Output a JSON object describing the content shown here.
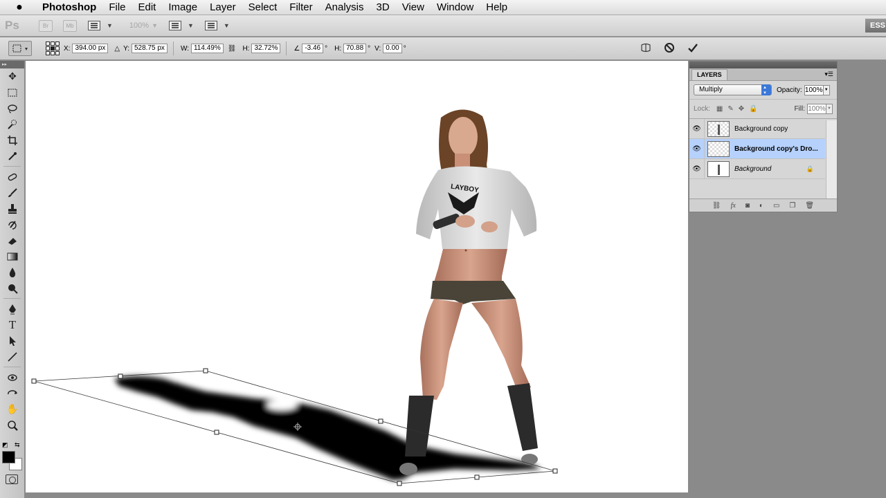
{
  "menubar": {
    "apple": "",
    "items": [
      "Photoshop",
      "File",
      "Edit",
      "Image",
      "Layer",
      "Select",
      "Filter",
      "Analysis",
      "3D",
      "View",
      "Window",
      "Help"
    ]
  },
  "appbar": {
    "logo": "Ps",
    "bridge": "Br",
    "minibridge": "Mb",
    "zoom": "100%",
    "workspace": "ESS"
  },
  "options": {
    "x_label": "X:",
    "x_value": "394.00 px",
    "y_label": "Y:",
    "y_value": "528.75 px",
    "w_label": "W:",
    "w_value": "114.49%",
    "h_label": "H:",
    "h_value": "32.72%",
    "angle_value": "-3.46",
    "deg": "°",
    "hskew_label": "H:",
    "hskew_value": "70.88",
    "vskew_label": "V:",
    "vskew_value": "0.00"
  },
  "layers_panel": {
    "tab": "LAYERS",
    "blend_mode": "Multiply",
    "opacity_label": "Opacity:",
    "opacity": "100%",
    "lock_label": "Lock:",
    "fill_label": "Fill:",
    "fill": "100%",
    "layers": [
      {
        "name": "Background copy",
        "selected": false
      },
      {
        "name": "Background copy's Dro...",
        "selected": true
      },
      {
        "name": "Background",
        "selected": false
      }
    ]
  },
  "colors": {
    "selection": "#b6d1fb",
    "accent": "#3b78d8"
  }
}
